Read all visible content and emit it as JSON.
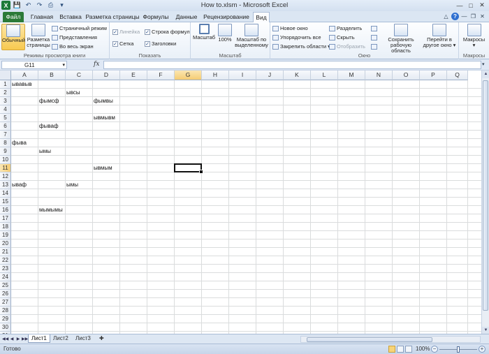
{
  "window": {
    "title": "How to.xlsm  -  Microsoft Excel",
    "logo": "X"
  },
  "tabs": [
    {
      "label": "Файл",
      "key": "file"
    },
    {
      "label": "Главная",
      "key": "home"
    },
    {
      "label": "Вставка",
      "key": "insert"
    },
    {
      "label": "Разметка страницы",
      "key": "layout"
    },
    {
      "label": "Формулы",
      "key": "formulas"
    },
    {
      "label": "Данные",
      "key": "data"
    },
    {
      "label": "Рецензирование",
      "key": "review"
    },
    {
      "label": "Вид",
      "key": "view",
      "active": true
    }
  ],
  "ribbon": {
    "views": {
      "label": "Режимы просмотра книги",
      "normal": "Обычный",
      "page_layout_1": "Разметка",
      "page_layout_2": "страницы",
      "page_break": "Страничный режим",
      "custom_views": "Представления",
      "fullscreen": "Во весь экран"
    },
    "show": {
      "label": "Показать",
      "ruler": "Линейка",
      "formula_bar": "Строка формул",
      "gridlines": "Сетка",
      "headings": "Заголовки"
    },
    "zoom": {
      "label": "Масштаб",
      "zoom": "Масштаб",
      "zoom100": "100%",
      "zoom_sel_1": "Масштаб по",
      "zoom_sel_2": "выделенному"
    },
    "window": {
      "label": "Окно",
      "new_window": "Новое окно",
      "arrange_all": "Упорядочить все",
      "freeze": "Закрепить области",
      "split": "Разделить",
      "hide": "Скрыть",
      "unhide": "Отобразить",
      "save_ws_1": "Сохранить",
      "save_ws_2": "рабочую область",
      "switch_1": "Перейти в",
      "switch_2": "другое окно"
    },
    "macros": {
      "label": "Макросы",
      "macros": "Макросы"
    }
  },
  "formula_bar": {
    "name_box": "G11",
    "fx": "fx",
    "formula": ""
  },
  "columns": [
    "A",
    "B",
    "C",
    "D",
    "E",
    "F",
    "G",
    "H",
    "I",
    "J",
    "K",
    "L",
    "M",
    "N",
    "O",
    "P",
    "Q"
  ],
  "rows": [
    "1",
    "2",
    "3",
    "4",
    "5",
    "6",
    "7",
    "8",
    "9",
    "10",
    "11",
    "12",
    "13",
    "14",
    "15",
    "16",
    "17",
    "18",
    "19",
    "20",
    "21",
    "22",
    "23",
    "24",
    "25",
    "26",
    "27",
    "28",
    "29",
    "30",
    "31"
  ],
  "selected_cell": {
    "col": "G",
    "row": "11"
  },
  "cells": [
    {
      "ref": "A1",
      "col": "A",
      "row": 1,
      "value": "ывавыв"
    },
    {
      "ref": "C2",
      "col": "C",
      "row": 2,
      "value": "ывсы"
    },
    {
      "ref": "B3",
      "col": "B",
      "row": 3,
      "value": "фымсф"
    },
    {
      "ref": "D3",
      "col": "D",
      "row": 3,
      "value": "фымвы"
    },
    {
      "ref": "D5",
      "col": "D",
      "row": 5,
      "value": "ывмывм"
    },
    {
      "ref": "B6",
      "col": "B",
      "row": 6,
      "value": "фываф"
    },
    {
      "ref": "A8",
      "col": "A",
      "row": 8,
      "value": "фыва"
    },
    {
      "ref": "B9",
      "col": "B",
      "row": 9,
      "value": "ымы"
    },
    {
      "ref": "D11",
      "col": "D",
      "row": 11,
      "value": "ывмым"
    },
    {
      "ref": "A13",
      "col": "A",
      "row": 13,
      "value": "ываф"
    },
    {
      "ref": "C13",
      "col": "C",
      "row": 13,
      "value": "ымы"
    },
    {
      "ref": "B16",
      "col": "B",
      "row": 16,
      "value": "мымымы"
    }
  ],
  "sheets": [
    {
      "label": "Лист1",
      "active": true
    },
    {
      "label": "Лист2"
    },
    {
      "label": "Лист3"
    }
  ],
  "status": {
    "ready": "Готово",
    "zoom": "100%"
  },
  "icons": {
    "save": "save-icon",
    "undo": "undo-icon",
    "redo": "redo-icon",
    "minimize": "minimize-icon",
    "maximize": "maximize-icon",
    "close": "close-icon",
    "help": "help-icon"
  }
}
